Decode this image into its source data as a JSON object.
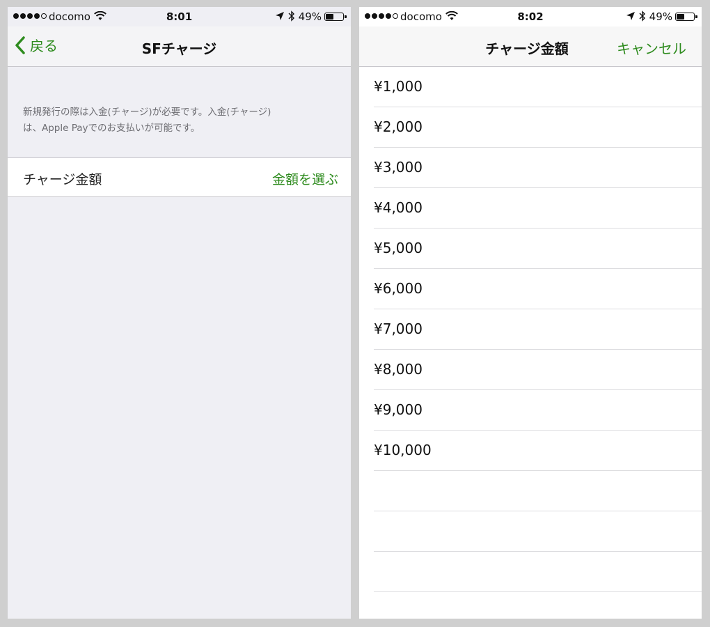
{
  "left": {
    "status": {
      "carrier": "docomo",
      "time": "8:01",
      "battery": "49%"
    },
    "nav": {
      "back_label": "戻る",
      "title": "SFチャージ"
    },
    "note_line1": "新規発行の際は入金(チャージ)が必要です。入金(チャージ)",
    "note_line2": "は、Apple Payでのお支払いが可能です。",
    "row": {
      "label": "チャージ金額",
      "value": "金額を選ぶ"
    }
  },
  "right": {
    "status": {
      "carrier": "docomo",
      "time": "8:02",
      "battery": "49%"
    },
    "nav": {
      "title": "チャージ金額",
      "cancel_label": "キャンセル"
    },
    "amounts": [
      "¥1,000",
      "¥2,000",
      "¥3,000",
      "¥4,000",
      "¥5,000",
      "¥6,000",
      "¥7,000",
      "¥8,000",
      "¥9,000",
      "¥10,000"
    ]
  },
  "colors": {
    "accent": "#2e8b1e",
    "background": "#efeff4"
  },
  "icons": [
    "signal-dots-icon",
    "wifi-icon",
    "location-arrow-icon",
    "bluetooth-icon",
    "battery-icon",
    "chevron-left-icon"
  ]
}
